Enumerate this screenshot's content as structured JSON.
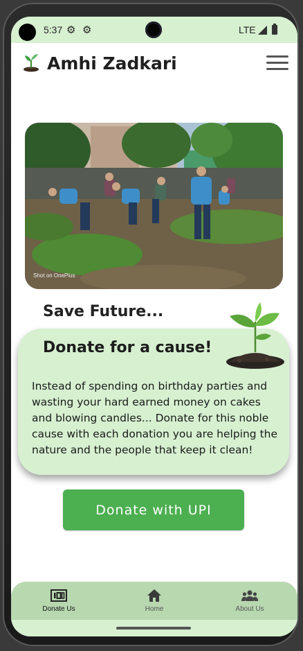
{
  "status_bar": {
    "time": "5:37",
    "network": "LTE"
  },
  "app": {
    "title": "Amhi Zadkari"
  },
  "hero": {
    "watermark": "Shot on OnePlus"
  },
  "content": {
    "subtitle": "Save Future...",
    "card_title": "Donate for a cause!",
    "card_body": "Instead of spending on birthday parties and wasting your hard earned money on cakes and blowing candles... Donate for this noble cause with each donation you are helping the nature and the people that keep it clean!",
    "donate_button": "Donate with UPI"
  },
  "bottom_nav": {
    "items": [
      {
        "label": "Donate Us",
        "icon": "donation-icon",
        "active": true
      },
      {
        "label": "Home",
        "icon": "home-icon",
        "active": false
      },
      {
        "label": "About Us",
        "icon": "group-icon",
        "active": false
      }
    ]
  },
  "colors": {
    "accent_green": "#4caf50",
    "light_green": "#d6f0d0",
    "nav_green": "#b8d8b0"
  }
}
